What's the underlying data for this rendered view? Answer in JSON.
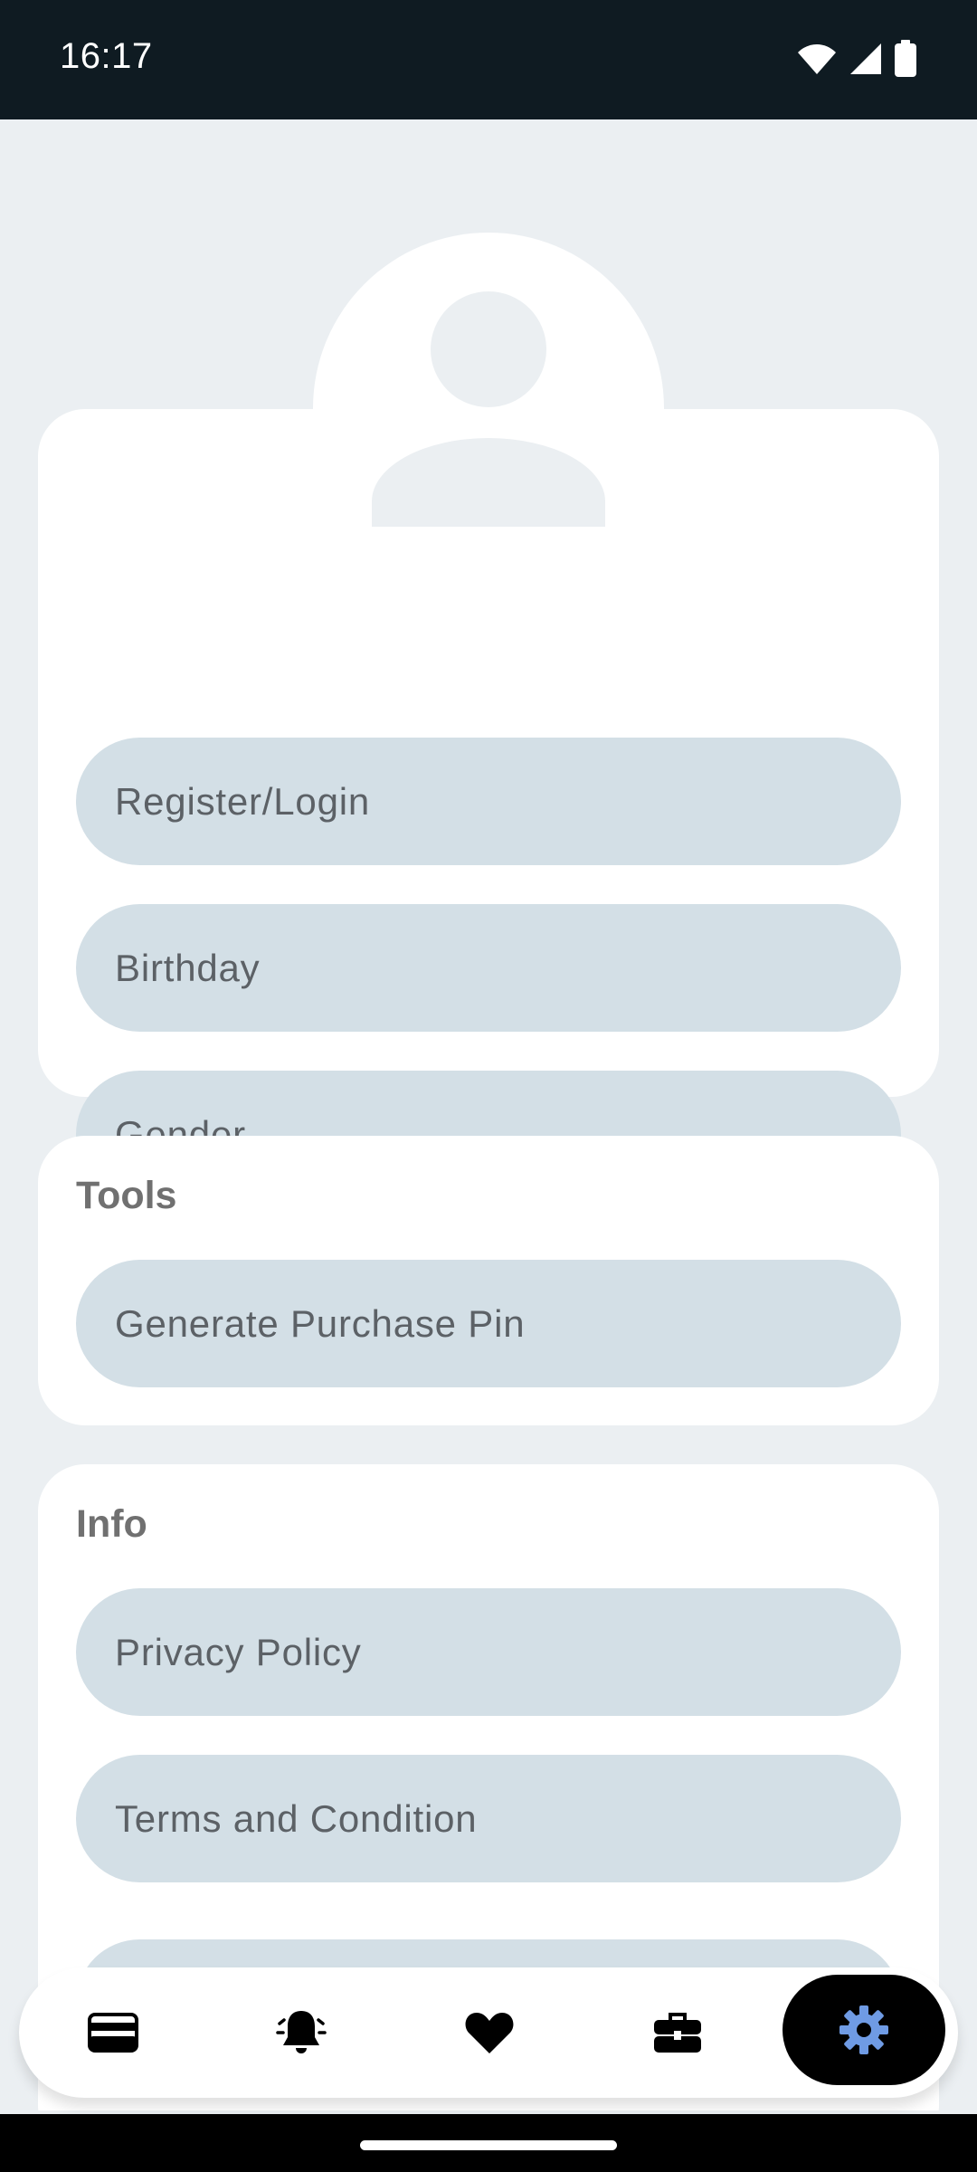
{
  "status_bar": {
    "time": "16:17",
    "icons": [
      "wifi-icon",
      "signal-icon",
      "battery-icon"
    ]
  },
  "profile": {
    "avatar_icon": "user-avatar-icon",
    "items": [
      {
        "label": "Register/Login"
      },
      {
        "label": "Birthday"
      },
      {
        "label": "Gender"
      }
    ]
  },
  "tools": {
    "title": "Tools",
    "items": [
      {
        "label": "Generate Purchase Pin"
      }
    ]
  },
  "info": {
    "title": "Info",
    "items": [
      {
        "label": "Privacy Policy"
      },
      {
        "label": "Terms and Condition"
      },
      {
        "label": ""
      }
    ]
  },
  "bottom_nav": {
    "items": [
      {
        "icon": "credit-card-icon",
        "active": false
      },
      {
        "icon": "bell-icon",
        "active": false
      },
      {
        "icon": "heart-icon",
        "active": false
      },
      {
        "icon": "briefcase-icon",
        "active": false
      },
      {
        "icon": "gear-icon",
        "active": true
      }
    ]
  },
  "colors": {
    "status_bar_bg": "#0f1b22",
    "page_bg": "#ebeff2",
    "pill_bg": "#d3dfe6",
    "active_nav_bg": "#000000",
    "active_icon": "#6f9be4"
  }
}
